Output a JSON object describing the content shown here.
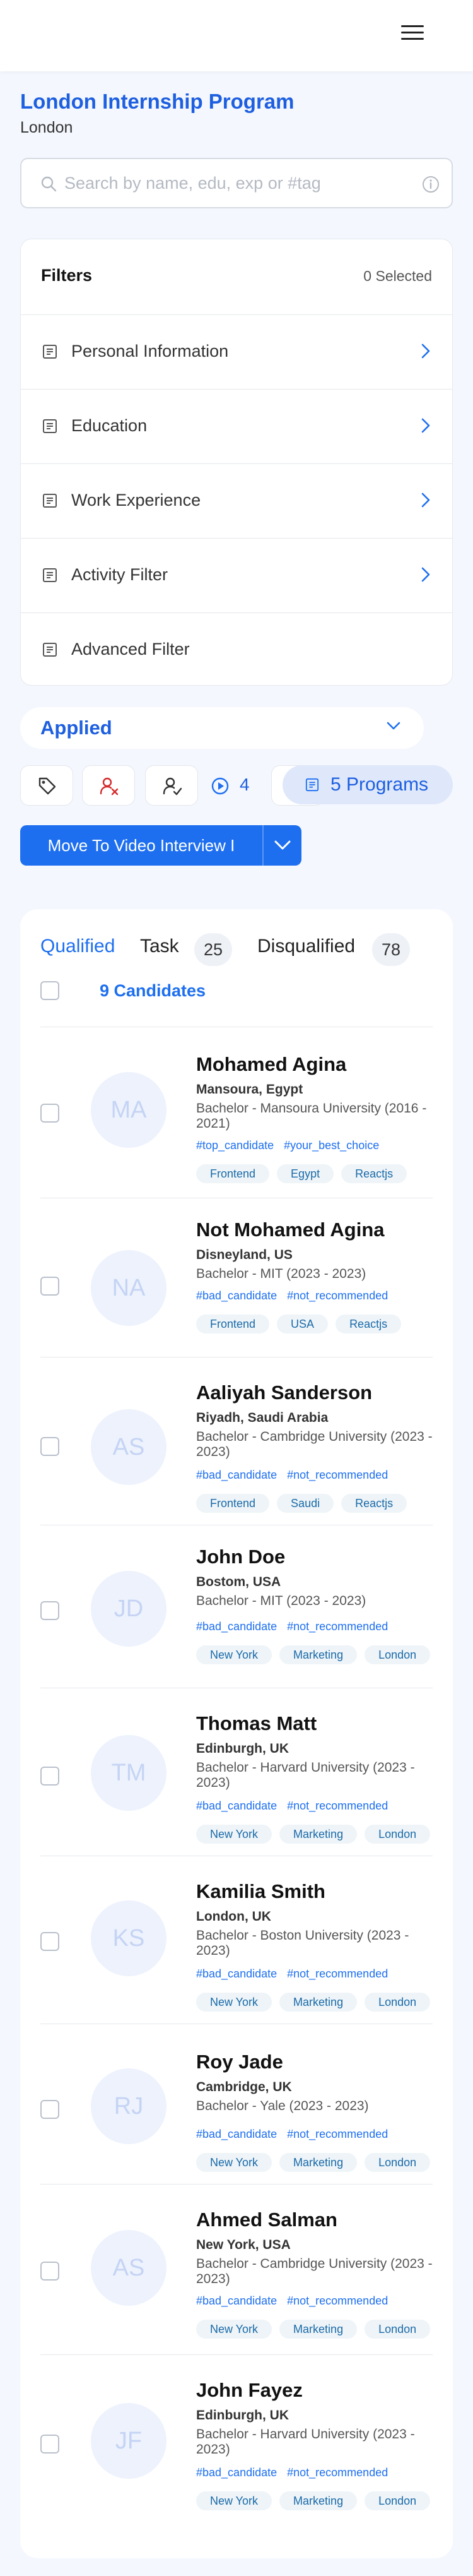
{
  "header": {
    "menu_icon": "hamburger-menu-icon"
  },
  "program": {
    "title": "London Internship Program",
    "location": "London"
  },
  "search": {
    "placeholder": "Search by name, edu, exp or #tag"
  },
  "filters": {
    "title": "Filters",
    "selected": "0 Selected",
    "items": [
      {
        "label": "Personal Information"
      },
      {
        "label": "Education"
      },
      {
        "label": "Work Experience"
      },
      {
        "label": "Activity Filter"
      },
      {
        "label": "Advanced Filter"
      }
    ]
  },
  "stage_select": {
    "value": "Applied"
  },
  "toolbar": {
    "video_count": "4",
    "programs_label": "5 Programs"
  },
  "move_button": {
    "label": "Move To Video Interview I"
  },
  "tabs": [
    {
      "label": "Qualified",
      "count": ""
    },
    {
      "label": "Task",
      "count": "25"
    },
    {
      "label": "Disqualified",
      "count": "78"
    }
  ],
  "candidates_count": "9 Candidates",
  "colors": {
    "accent": "#1d6ff0",
    "title": "#1d5fe0",
    "disqualify": "#d42a2a"
  },
  "candidates": [
    {
      "initials": "MA",
      "name": "Mohamed Agina",
      "location": "Mansoura, Egypt",
      "education": "Bachelor - Mansoura University (2016 - 2021)",
      "tags": [
        "#top_candidate",
        "#your_best_choice"
      ],
      "skills": [
        "Frontend",
        "Egypt",
        "Reactjs"
      ]
    },
    {
      "initials": "NA",
      "name": "Not Mohamed Agina",
      "location": "Disneyland, US",
      "education": "Bachelor - MIT (2023 - 2023)",
      "tags": [
        "#bad_candidate",
        "#not_recommended"
      ],
      "skills": [
        "Frontend",
        "USA",
        "Reactjs"
      ]
    },
    {
      "initials": "AS",
      "name": "Aaliyah Sanderson",
      "location": "Riyadh, Saudi Arabia",
      "education": "Bachelor - Cambridge University (2023 - 2023)",
      "tags": [
        "#bad_candidate",
        "#not_recommended"
      ],
      "skills": [
        "Frontend",
        "Saudi",
        "Reactjs"
      ]
    },
    {
      "initials": "JD",
      "name": "John Doe",
      "location": "Bostom, USA",
      "education": "Bachelor - MIT (2023 - 2023)",
      "tags": [
        "#bad_candidate",
        "#not_recommended"
      ],
      "skills": [
        "New York",
        "Marketing",
        "London"
      ]
    },
    {
      "initials": "TM",
      "name": "Thomas Matt",
      "location": "Edinburgh, UK",
      "education": "Bachelor - Harvard University (2023 - 2023)",
      "tags": [
        "#bad_candidate",
        "#not_recommended"
      ],
      "skills": [
        "New York",
        "Marketing",
        "London"
      ]
    },
    {
      "initials": "KS",
      "name": "Kamilia Smith",
      "location": "London, UK",
      "education": "Bachelor - Boston University (2023 - 2023)",
      "tags": [
        "#bad_candidate",
        "#not_recommended"
      ],
      "skills": [
        "New York",
        "Marketing",
        "London"
      ]
    },
    {
      "initials": "RJ",
      "name": "Roy Jade",
      "location": "Cambridge, UK",
      "education": "Bachelor - Yale (2023 - 2023)",
      "tags": [
        "#bad_candidate",
        "#not_recommended"
      ],
      "skills": [
        "New York",
        "Marketing",
        "London"
      ]
    },
    {
      "initials": "AS",
      "name": "Ahmed Salman",
      "location": "New York, USA",
      "education": "Bachelor - Cambridge University (2023 - 2023)",
      "tags": [
        "#bad_candidate",
        "#not_recommended"
      ],
      "skills": [
        "New York",
        "Marketing",
        "London"
      ]
    },
    {
      "initials": "JF",
      "name": "John Fayez",
      "location": "Edinburgh, UK",
      "education": "Bachelor - Harvard University (2023 - 2023)",
      "tags": [
        "#bad_candidate",
        "#not_recommended"
      ],
      "skills": [
        "New York",
        "Marketing",
        "London"
      ]
    }
  ]
}
